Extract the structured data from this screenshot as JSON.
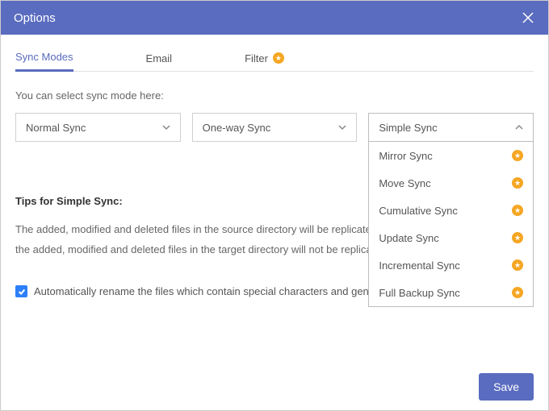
{
  "titlebar": {
    "title": "Options"
  },
  "tabs": {
    "sync_modes": "Sync Modes",
    "email": "Email",
    "filter": "Filter"
  },
  "prompt": "You can select sync mode here:",
  "selects": {
    "mode1": "Normal Sync",
    "mode2": "One-way Sync",
    "mode3": "Simple Sync"
  },
  "dropdown": {
    "items": [
      {
        "label": "Mirror Sync",
        "premium": true
      },
      {
        "label": "Move Sync",
        "premium": true
      },
      {
        "label": "Cumulative Sync",
        "premium": true
      },
      {
        "label": "Update Sync",
        "premium": true
      },
      {
        "label": "Incremental Sync",
        "premium": true
      },
      {
        "label": "Full Backup Sync",
        "premium": true
      }
    ]
  },
  "tips": {
    "heading": "Tips for Simple Sync:",
    "body": "The added, modified and deleted files in the source directory will be replicated to the target directory. However, the added, modified and deleted files in the target directory will not be replicated to the source directory."
  },
  "checkbox": {
    "label": "Automatically rename the files which contain special characters and generate a script file."
  },
  "footer": {
    "save": "Save"
  },
  "colors": {
    "accent": "#5a6cbf",
    "premium": "#f5a623"
  }
}
